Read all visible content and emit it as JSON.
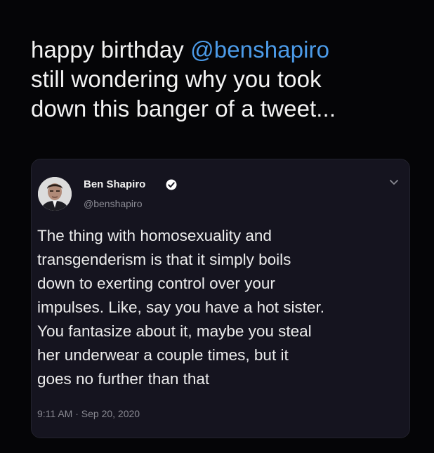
{
  "caption": {
    "lines": [
      {
        "before": "happy birthday ",
        "mention": "@benshapiro"
      },
      {
        "text": "still wondering why you took"
      },
      {
        "text": "down this banger of a tweet..."
      }
    ]
  },
  "tweet": {
    "author_name": "Ben Shapiro",
    "author_handle": "@benshapiro",
    "avatar_icon": "profile-photo",
    "verified_icon": "verified-badge-icon",
    "menu_icon": "chevron-down-icon",
    "body_lines": [
      "The thing with homosexuality and",
      "transgenderism is that it simply boils",
      "down to exerting control over your",
      "impulses. Like, say you have a hot sister.",
      "You fantasize about it, maybe you steal",
      "her underwear a couple times, but it",
      "goes no further than that"
    ],
    "timestamp": "9:11 AM · Sep 20, 2020"
  },
  "colors": {
    "background": "#050507",
    "card_background": "#15141f",
    "mention": "#4c9be8",
    "verified": "#ffffff",
    "muted_text": "#8a8a93"
  }
}
